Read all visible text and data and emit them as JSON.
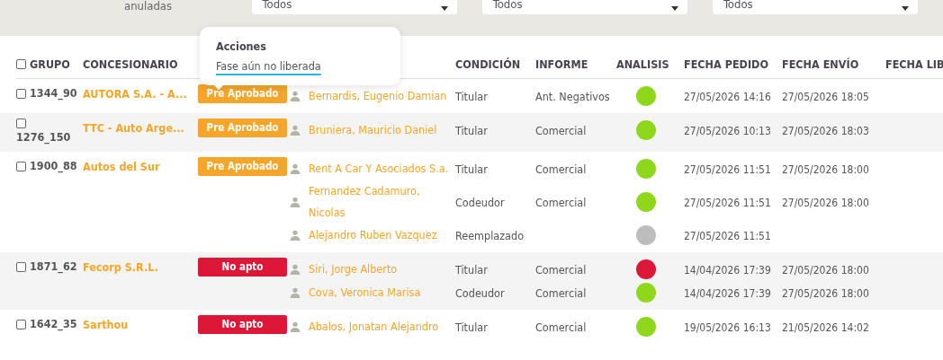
{
  "filters": {
    "label": "anuladas",
    "selects": [
      {
        "value": "Todos"
      },
      {
        "value": "Todos"
      },
      {
        "value": "Todos"
      }
    ]
  },
  "popover": {
    "title": "Acciones",
    "link": "Fase aún no liberada"
  },
  "table": {
    "select_all": {
      "checked": false
    },
    "columns": [
      "GRUPO",
      "CONCESIONARIO",
      "CONDICIÓN",
      "INFORME",
      "ANALISIS",
      "FECHA PEDIDO",
      "FECHA ENVÍO",
      "FECHA LIB"
    ],
    "groups": [
      {
        "checked": false,
        "grupo": "1344_90",
        "concesionario": "AUTORA S.A. - A...",
        "status": "Pre Aprobado",
        "color": "#f5a62a",
        "persons": [
          {
            "name": "Bernardis, Eugenio Damian",
            "condicion": "Titular",
            "informe": "Ant. Negativos",
            "color": "#8fd71b",
            "fecha_pedido": "27/05/2026 14:16",
            "fecha_envio": "27/05/2026 18:05"
          }
        ]
      },
      {
        "checked": false,
        "grupo": "1276_150",
        "concesionario": "TTC - Auto Arge...",
        "status": "Pre Aprobado",
        "color": "#f5a62a",
        "persons": [
          {
            "name": "Bruniera, Mauricio Daniel",
            "condicion": "Titular",
            "informe": "Comercial",
            "color": "#8fd71b",
            "fecha_pedido": "27/05/2026 10:13",
            "fecha_envio": "27/05/2026 18:03"
          }
        ]
      },
      {
        "checked": false,
        "grupo": "1900_88",
        "concesionario": "Autos del Sur",
        "status": "Pre Aprobado",
        "color": "#f5a62a",
        "persons": [
          {
            "name": "Rent A Car Y Asociados S.a.",
            "condicion": "Titular",
            "informe": "Comercial",
            "color": "#8fd71b",
            "fecha_pedido": "27/05/2026 11:51",
            "fecha_envio": "27/05/2026 18:00"
          },
          {
            "name": "Fernandez Cadamuro, Nicolas",
            "condicion": "Codeudor",
            "informe": "Comercial",
            "color": "#8fd71b",
            "fecha_pedido": "27/05/2026 11:51",
            "fecha_envio": "27/05/2026 18:00"
          },
          {
            "name": "Alejandro Ruben Vazquez",
            "condicion": "Reemplazado",
            "color": "#bdbdbd",
            "fecha_pedido": "27/05/2026 11:51"
          }
        ]
      },
      {
        "checked": false,
        "grupo": "1871_62",
        "concesionario": "Fecorp S.R.L.",
        "status": "No apto",
        "color": "#dc1738",
        "persons": [
          {
            "name": "Siri, Jorge Alberto",
            "condicion": "Titular",
            "informe": "Comercial",
            "color": "#dc1738",
            "fecha_pedido": "14/04/2026 17:39",
            "fecha_envio": "27/05/2026 18:00"
          },
          {
            "name": "Cova, Veronica Marisa",
            "condicion": "Codeudor",
            "informe": "Comercial",
            "color": "#8fd71b",
            "fecha_pedido": "14/04/2026 17:39",
            "fecha_envio": "27/05/2026 18:00"
          }
        ]
      },
      {
        "checked": false,
        "grupo": "1642_35",
        "concesionario": "Sarthou",
        "status": "No apto",
        "color": "#dc1738",
        "persons": [
          {
            "name": "Abalos, Jonatan Alejandro",
            "condicion": "Titular",
            "informe": "Comercial",
            "color": "#8fd71b",
            "fecha_pedido": "19/05/2026 16:13",
            "fecha_envio": "21/05/2026 14:02"
          }
        ]
      }
    ]
  }
}
